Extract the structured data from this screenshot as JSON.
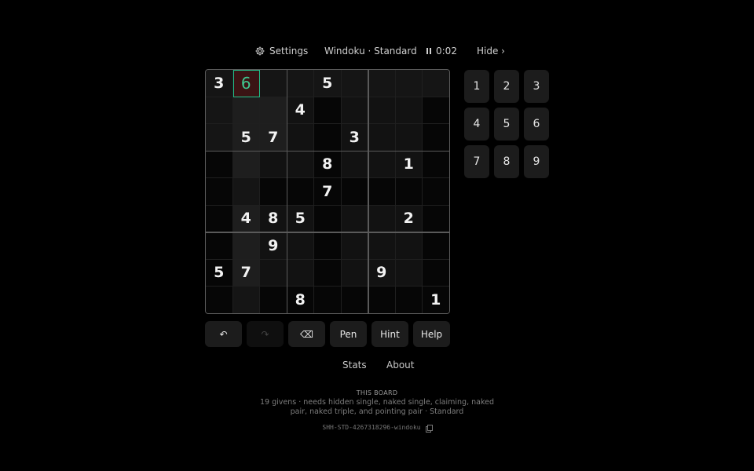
{
  "topbar": {
    "settings_label": "Settings",
    "title": "Windoku · Standard",
    "timer": "0:02",
    "hide_label": "Hide ›"
  },
  "grid": [
    [
      3,
      6,
      0,
      0,
      5,
      0,
      0,
      0,
      0
    ],
    [
      0,
      0,
      0,
      4,
      0,
      0,
      0,
      0,
      0
    ],
    [
      0,
      5,
      7,
      0,
      0,
      3,
      0,
      0,
      0
    ],
    [
      0,
      0,
      0,
      0,
      8,
      0,
      0,
      1,
      0
    ],
    [
      0,
      0,
      0,
      0,
      7,
      0,
      0,
      0,
      0
    ],
    [
      0,
      4,
      8,
      5,
      0,
      0,
      0,
      2,
      0
    ],
    [
      0,
      0,
      9,
      0,
      0,
      0,
      0,
      0,
      0
    ],
    [
      5,
      7,
      0,
      0,
      0,
      0,
      9,
      0,
      0
    ],
    [
      0,
      0,
      0,
      8,
      0,
      0,
      0,
      0,
      1
    ]
  ],
  "selected_cell": {
    "row": 1,
    "col": 2
  },
  "numpad": [
    "1",
    "2",
    "3",
    "4",
    "5",
    "6",
    "7",
    "8",
    "9"
  ],
  "controls": {
    "undo": "↶",
    "redo": "↷",
    "erase": "⌫",
    "pen": "Pen",
    "hint": "Hint",
    "help": "Help"
  },
  "links": {
    "stats": "Stats",
    "about": "About"
  },
  "info": {
    "title": "THIS BOARD",
    "description": "19 givens · needs hidden single, naked single, claiming, naked pair, naked triple, and pointing pair · Standard",
    "board_id": "SHH-STD-4267318296-windoku"
  },
  "colors": {
    "accent": "#22c08a",
    "selected_bg": "#3a1414"
  }
}
